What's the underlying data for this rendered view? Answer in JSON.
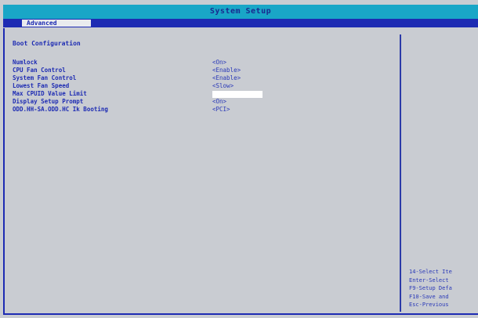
{
  "window": {
    "title": "System Setup"
  },
  "tabs": [
    {
      "label": "Advanced"
    }
  ],
  "section": {
    "title": "Boot Configuration"
  },
  "settings": [
    {
      "label": "Numlock",
      "value": "<On>"
    },
    {
      "label": "CPU Fan Control",
      "value": "<Enable>"
    },
    {
      "label": "System Fan Control",
      "value": "<Enable>"
    },
    {
      "label": "Lowest Fan Speed",
      "value": "<Slow>"
    },
    {
      "label": "Max CPUID Value Limit",
      "value": ""
    },
    {
      "label": "Display Setup Prompt",
      "value": "<On>"
    },
    {
      "label": "ODD.HH-SA.ODD.HC Ik Booting",
      "value": "<PCI>"
    }
  ],
  "help": {
    "lines": [
      "14-Select Ite",
      "Enter-Select",
      "F9-Setup Defa",
      "F10-Save and",
      "Esc-Previous"
    ]
  }
}
